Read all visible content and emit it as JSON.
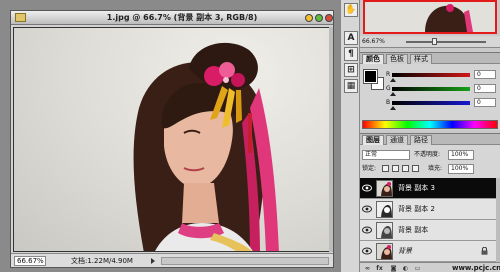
{
  "document": {
    "title": "1.jpg @ 66.7% (背景 副本 3, RGB/8)",
    "zoom": "66.67%",
    "doc_size": "文档:1.22M/4.90M"
  },
  "navigator": {
    "zoom": "66.67%"
  },
  "tool_strip": {
    "buttons": [
      "✋",
      "A",
      "¶",
      "⊞",
      "▦"
    ]
  },
  "color_panel": {
    "tabs": [
      "颜色",
      "色板",
      "样式"
    ],
    "channels": [
      {
        "label": "R",
        "value": "0",
        "color": "#d01818"
      },
      {
        "label": "G",
        "value": "0",
        "color": "#18a018"
      },
      {
        "label": "B",
        "value": "0",
        "color": "#1818d0"
      }
    ],
    "foreground": "#000000",
    "background": "#ffffff"
  },
  "layers_panel": {
    "tabs": [
      "图层",
      "通道",
      "路径"
    ],
    "blend_mode": "正常",
    "opacity_label": "不透明度:",
    "opacity": "100%",
    "lock_label": "锁定:",
    "fill_label": "填充:",
    "fill": "100%",
    "layers": [
      {
        "name": "背景 副本 3",
        "selected": true
      },
      {
        "name": "背景 副本 2",
        "selected": false
      },
      {
        "name": "背景 副本",
        "selected": false
      },
      {
        "name": "背景",
        "selected": false,
        "locked": true
      }
    ],
    "footer_icons": [
      "link",
      "fx",
      "mask",
      "adjust",
      "folder"
    ],
    "watermark": "www.pcjc.cn"
  }
}
